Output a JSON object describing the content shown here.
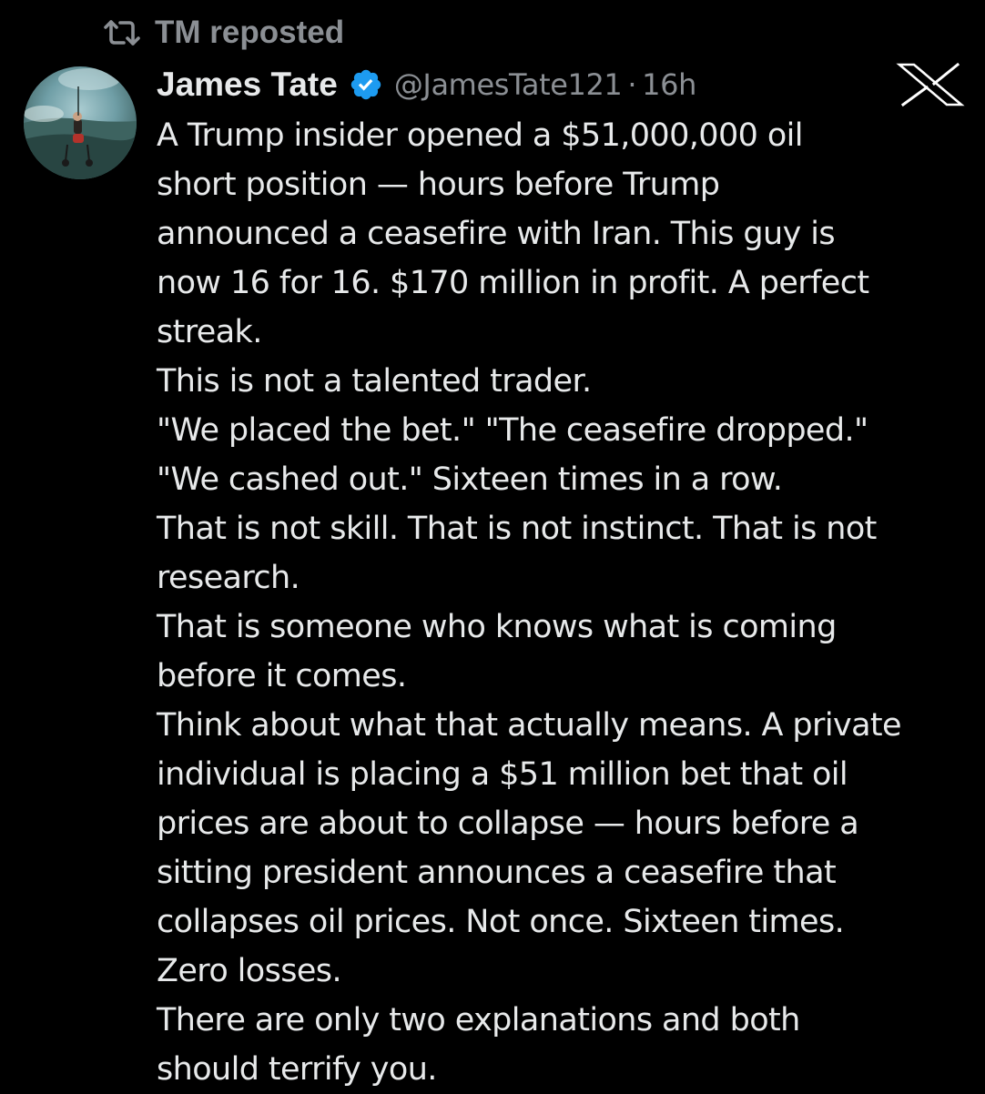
{
  "repost": {
    "icon": "repost-icon",
    "text": "TM reposted"
  },
  "tweet": {
    "author": {
      "display_name": "James Tate",
      "verified_icon": "verified-badge-icon",
      "handle": "@JamesTate121",
      "separator": "·",
      "time": "16h"
    },
    "platform_logo": "x-logo-icon",
    "lines": [
      "A Trump insider opened a $51,000,000 oil",
      "short position — hours before Trump",
      "announced a ceasefire with Iran. This guy is",
      "now 16 for 16. $170 million in profit. A perfect",
      "streak.",
      "This is not a talented trader.",
      "\"We placed the bet.\" \"The ceasefire dropped.\"",
      "\"We cashed out.\" Sixteen times in a row.",
      "That is not skill. That is not instinct. That is not",
      "research.",
      "That is someone who knows what is coming",
      "before it comes.",
      "Think about what that actually means. A private",
      "individual is placing a $51 million bet that oil",
      "prices are about to collapse — hours before a",
      "sitting president announces a ceasefire that",
      "collapses oil prices. Not once. Sixteen times.",
      "Zero losses.",
      "There are only two explanations and both",
      "should terrify you."
    ]
  },
  "colors": {
    "background": "#000000",
    "primary_text": "#e7e9ea",
    "secondary_text": "#8b8f94",
    "verified_blue": "#1d9bf0"
  }
}
